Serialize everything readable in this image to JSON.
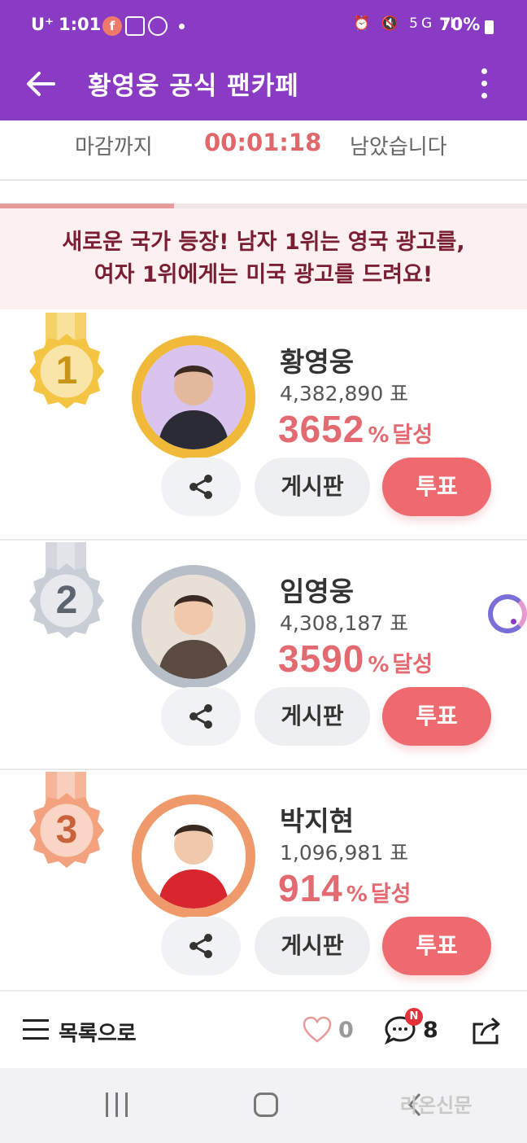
{
  "status_bar": {
    "carrier": "U⁺",
    "time": "1:01",
    "notif_badge": "f",
    "sys_icons": "⏰ 🔇 5G ıll",
    "battery": "70%"
  },
  "app_bar": {
    "title": "황영웅 공식 팬카페",
    "back_icon": "arrow-left-icon",
    "menu_icon": "more-vertical-icon"
  },
  "timer": {
    "prefix": "마감까지",
    "remaining": "00:01:18",
    "suffix": "남았습니다",
    "progress_fraction": 0.33
  },
  "notice": {
    "line1": "새로운 국가 등장! 남자 1위는 영국 광고를,",
    "line2": "여자 1위에게는 미국 광고를 드려요!"
  },
  "ranks": [
    {
      "rank": "1",
      "name": "황영웅",
      "votes": "4,382,890 표",
      "percent": "3652",
      "percent_symbol": "%",
      "percent_label": "달성",
      "board_label": "게시판",
      "vote_label": "투표",
      "medal_color": "#f4c542",
      "ring_color": "#f0b93a"
    },
    {
      "rank": "2",
      "name": "임영웅",
      "votes": "4,308,187 표",
      "percent": "3590",
      "percent_symbol": "%",
      "percent_label": "달성",
      "board_label": "게시판",
      "vote_label": "투표",
      "medal_color": "#c9ced6",
      "ring_color": "#b8bec7"
    },
    {
      "rank": "3",
      "name": "박지현",
      "votes": "1,096,981 표",
      "percent": "914",
      "percent_symbol": "%",
      "percent_label": "달성",
      "board_label": "게시판",
      "vote_label": "투표",
      "medal_color": "#f2a27e",
      "ring_color": "#ef9a6a"
    }
  ],
  "bottom_bar": {
    "list_label": "목록으로",
    "like_count": "0",
    "comment_badge": "N",
    "comment_count": "8"
  },
  "watermark": "라온신문",
  "colors": {
    "brand_purple": "#8a3bc4",
    "accent_red": "#ee6a6e",
    "timer_red": "#e0686a"
  }
}
